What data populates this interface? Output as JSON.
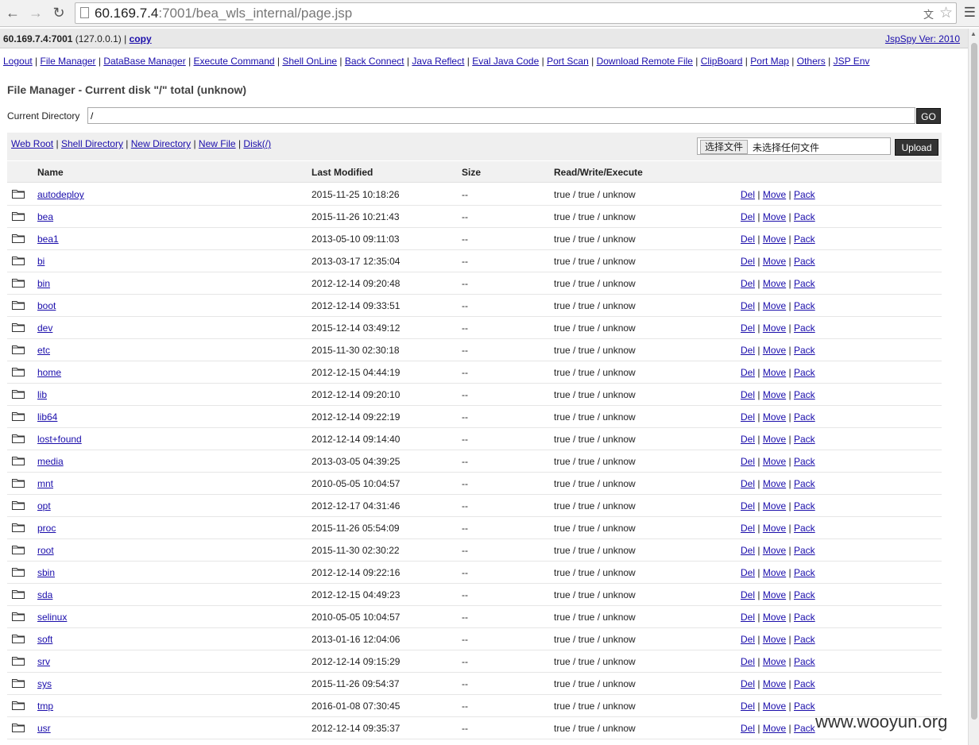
{
  "browser": {
    "url_host": "60.169.7.4",
    "url_rest": ":7001/bea_wls_internal/page.jsp"
  },
  "header": {
    "host": "60.169.7.4:7001",
    "ip": "(127.0.0.1)",
    "sep": "|",
    "copy": "copy",
    "version": "JspSpy Ver: 2010"
  },
  "menu": [
    "Logout",
    "File Manager",
    "DataBase Manager",
    "Execute Command",
    "Shell OnLine",
    "Back Connect",
    "Java Reflect",
    "Eval Java Code",
    "Port Scan",
    "Download Remote File",
    "ClipBoard",
    "Port Map",
    "Others",
    "JSP Env"
  ],
  "file_manager": {
    "title": "File Manager - Current disk \"/\" total (unknow)",
    "current_dir_label": "Current Directory",
    "current_dir_value": "/",
    "go": "GO",
    "tools": [
      "Web Root",
      "Shell Directory",
      "New Directory",
      "New File",
      "Disk(/)"
    ],
    "choose_file": "选择文件",
    "no_file": "未选择任何文件",
    "upload": "Upload"
  },
  "columns": {
    "name": "Name",
    "modified": "Last Modified",
    "size": "Size",
    "rwx": "Read/Write/Execute"
  },
  "actions": {
    "del": "Del",
    "move": "Move",
    "pack": "Pack",
    "sep": "|"
  },
  "rows": [
    {
      "name": "autodeploy",
      "modified": "2015-11-25 10:18:26",
      "size": "--",
      "rwx": "true / true / unknow"
    },
    {
      "name": "bea",
      "modified": "2015-11-26 10:21:43",
      "size": "--",
      "rwx": "true / true / unknow"
    },
    {
      "name": "bea1",
      "modified": "2013-05-10 09:11:03",
      "size": "--",
      "rwx": "true / true / unknow"
    },
    {
      "name": "bi",
      "modified": "2013-03-17 12:35:04",
      "size": "--",
      "rwx": "true / true / unknow"
    },
    {
      "name": "bin",
      "modified": "2012-12-14 09:20:48",
      "size": "--",
      "rwx": "true / true / unknow"
    },
    {
      "name": "boot",
      "modified": "2012-12-14 09:33:51",
      "size": "--",
      "rwx": "true / true / unknow"
    },
    {
      "name": "dev",
      "modified": "2015-12-14 03:49:12",
      "size": "--",
      "rwx": "true / true / unknow"
    },
    {
      "name": "etc",
      "modified": "2015-11-30 02:30:18",
      "size": "--",
      "rwx": "true / true / unknow"
    },
    {
      "name": "home",
      "modified": "2012-12-15 04:44:19",
      "size": "--",
      "rwx": "true / true / unknow"
    },
    {
      "name": "lib",
      "modified": "2012-12-14 09:20:10",
      "size": "--",
      "rwx": "true / true / unknow"
    },
    {
      "name": "lib64",
      "modified": "2012-12-14 09:22:19",
      "size": "--",
      "rwx": "true / true / unknow"
    },
    {
      "name": "lost+found",
      "modified": "2012-12-14 09:14:40",
      "size": "--",
      "rwx": "true / true / unknow"
    },
    {
      "name": "media",
      "modified": "2013-03-05 04:39:25",
      "size": "--",
      "rwx": "true / true / unknow"
    },
    {
      "name": "mnt",
      "modified": "2010-05-05 10:04:57",
      "size": "--",
      "rwx": "true / true / unknow"
    },
    {
      "name": "opt",
      "modified": "2012-12-17 04:31:46",
      "size": "--",
      "rwx": "true / true / unknow"
    },
    {
      "name": "proc",
      "modified": "2015-11-26 05:54:09",
      "size": "--",
      "rwx": "true / true / unknow"
    },
    {
      "name": "root",
      "modified": "2015-11-30 02:30:22",
      "size": "--",
      "rwx": "true / true / unknow"
    },
    {
      "name": "sbin",
      "modified": "2012-12-14 09:22:16",
      "size": "--",
      "rwx": "true / true / unknow"
    },
    {
      "name": "sda",
      "modified": "2012-12-15 04:49:23",
      "size": "--",
      "rwx": "true / true / unknow"
    },
    {
      "name": "selinux",
      "modified": "2010-05-05 10:04:57",
      "size": "--",
      "rwx": "true / true / unknow"
    },
    {
      "name": "soft",
      "modified": "2013-01-16 12:04:06",
      "size": "--",
      "rwx": "true / true / unknow"
    },
    {
      "name": "srv",
      "modified": "2012-12-14 09:15:29",
      "size": "--",
      "rwx": "true / true / unknow"
    },
    {
      "name": "sys",
      "modified": "2015-11-26 09:54:37",
      "size": "--",
      "rwx": "true / true / unknow"
    },
    {
      "name": "tmp",
      "modified": "2016-01-08 07:30:45",
      "size": "--",
      "rwx": "true / true / unknow"
    },
    {
      "name": "usr",
      "modified": "2012-12-14 09:35:37",
      "size": "--",
      "rwx": "true / true / unknow"
    }
  ],
  "watermark": "www.wooyun.org"
}
